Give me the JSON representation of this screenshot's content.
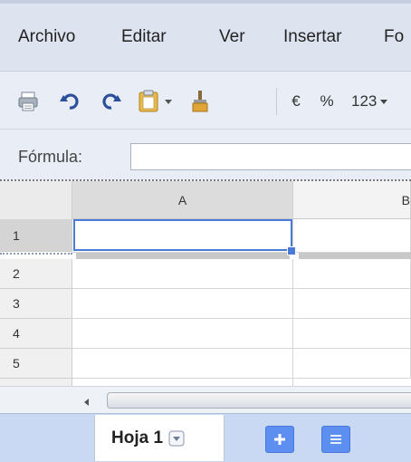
{
  "menu": {
    "items": [
      "Archivo",
      "Editar",
      "Ver",
      "Insertar",
      "Fo"
    ]
  },
  "toolbar": {
    "icons": [
      "print-icon",
      "undo-icon",
      "redo-icon",
      "paste-icon",
      "paint-format-icon"
    ],
    "currency": "€",
    "percent": "%",
    "number_format": "123"
  },
  "formula": {
    "label": "Fórmula:",
    "value": ""
  },
  "grid": {
    "columns": [
      "A",
      "B"
    ],
    "rows": [
      "1",
      "2",
      "3",
      "4",
      "5"
    ],
    "selected_cell": "A1"
  },
  "sheets": {
    "active_label": "Hoja 1",
    "add_icon": "plus-icon",
    "list_icon": "sheet-list-icon"
  },
  "colors": {
    "menubar": "#dde4f0",
    "toolbar": "#e8edf6",
    "selection": "#4a7bd6",
    "tab_bar": "#c9d9f4",
    "blue_buttons": "#5c8ff0"
  }
}
